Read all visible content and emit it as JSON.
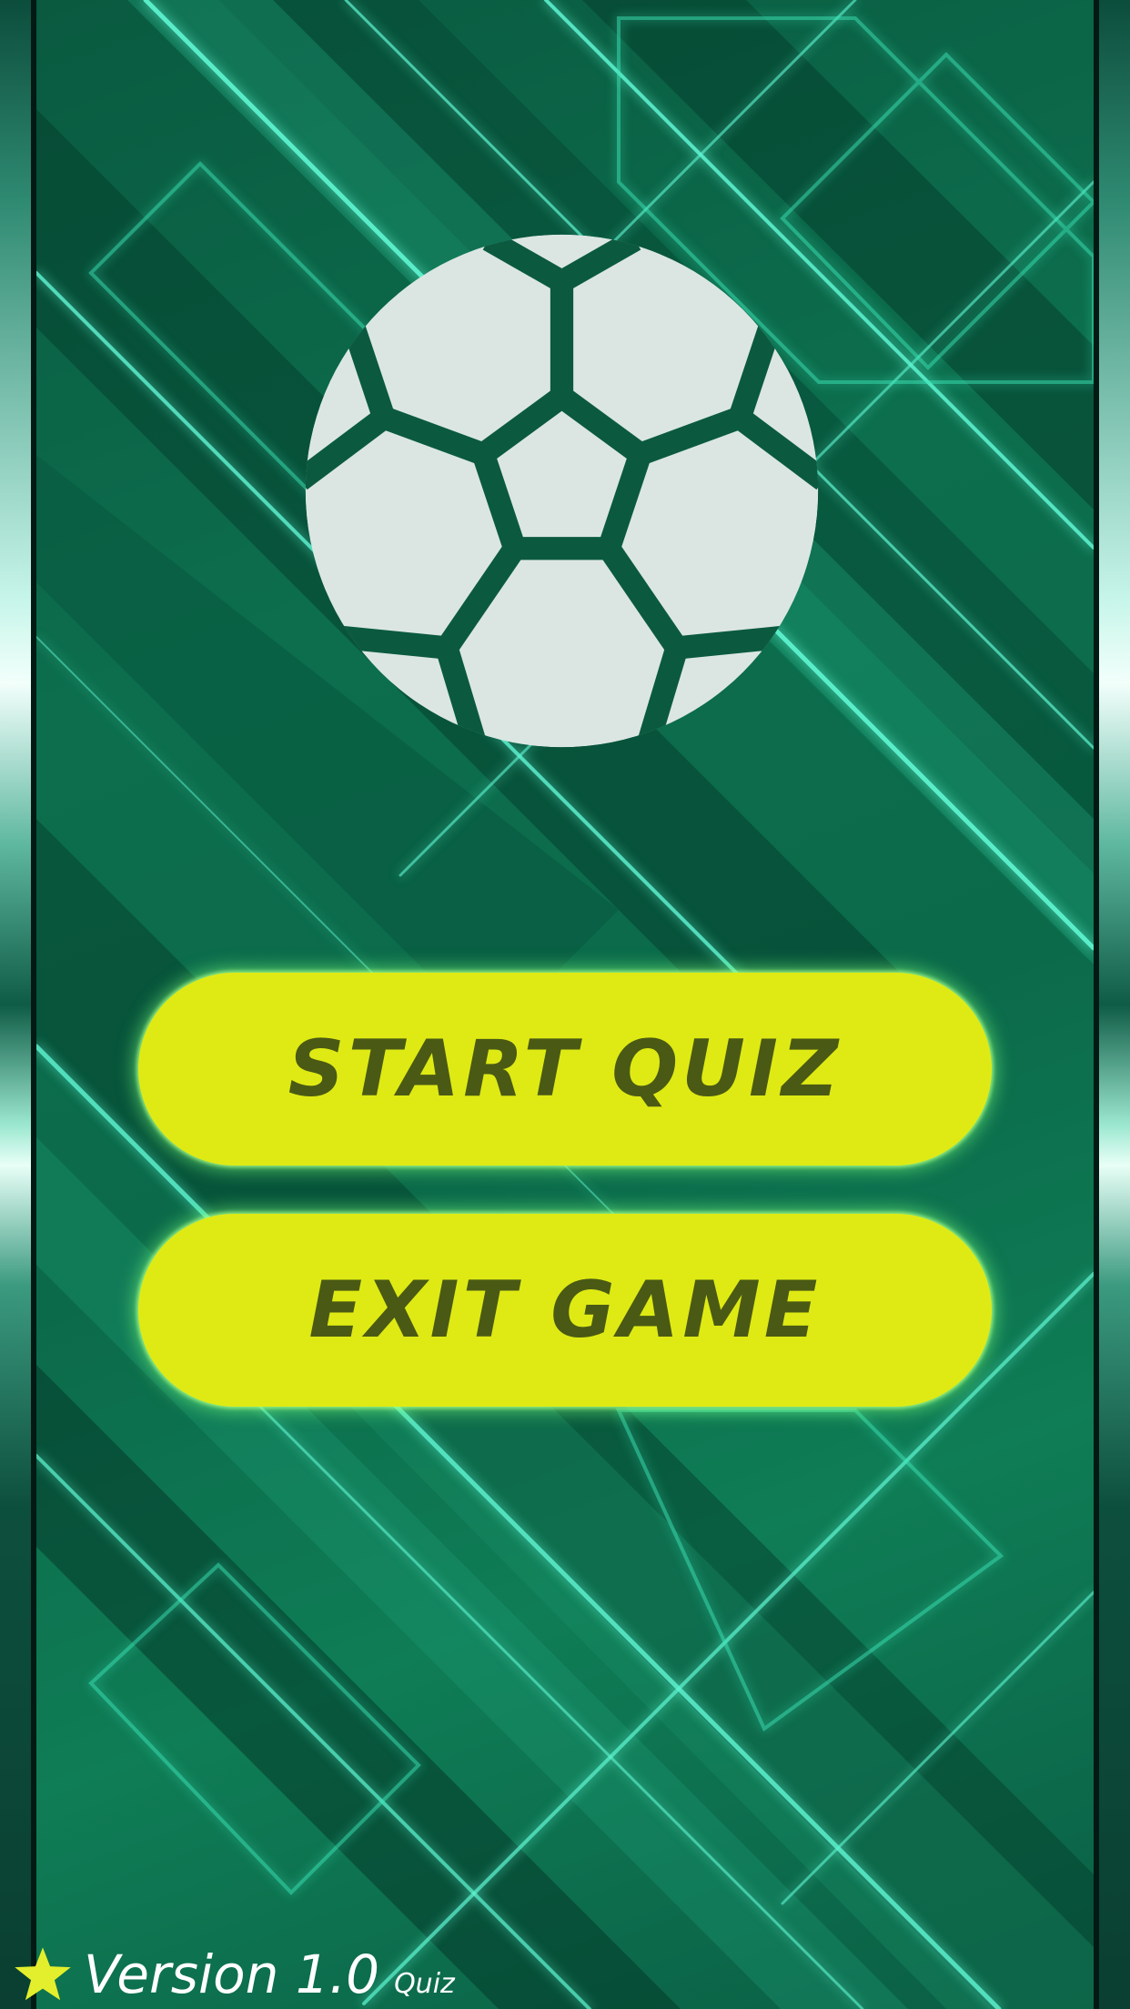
{
  "menu": {
    "start_label": "START QUIZ",
    "exit_label": "EXIT GAME"
  },
  "footer": {
    "version_label": "Version 1.0",
    "version_sub": "Quiz"
  },
  "icons": {
    "logo": "soccer-ball-icon",
    "footer": "star-icon"
  },
  "colors": {
    "button_fill": "#dfea14",
    "button_text": "#4a5a14",
    "background": "#0b6a4a",
    "ball": "#dbe6e2",
    "star": "#e3ef2c"
  }
}
